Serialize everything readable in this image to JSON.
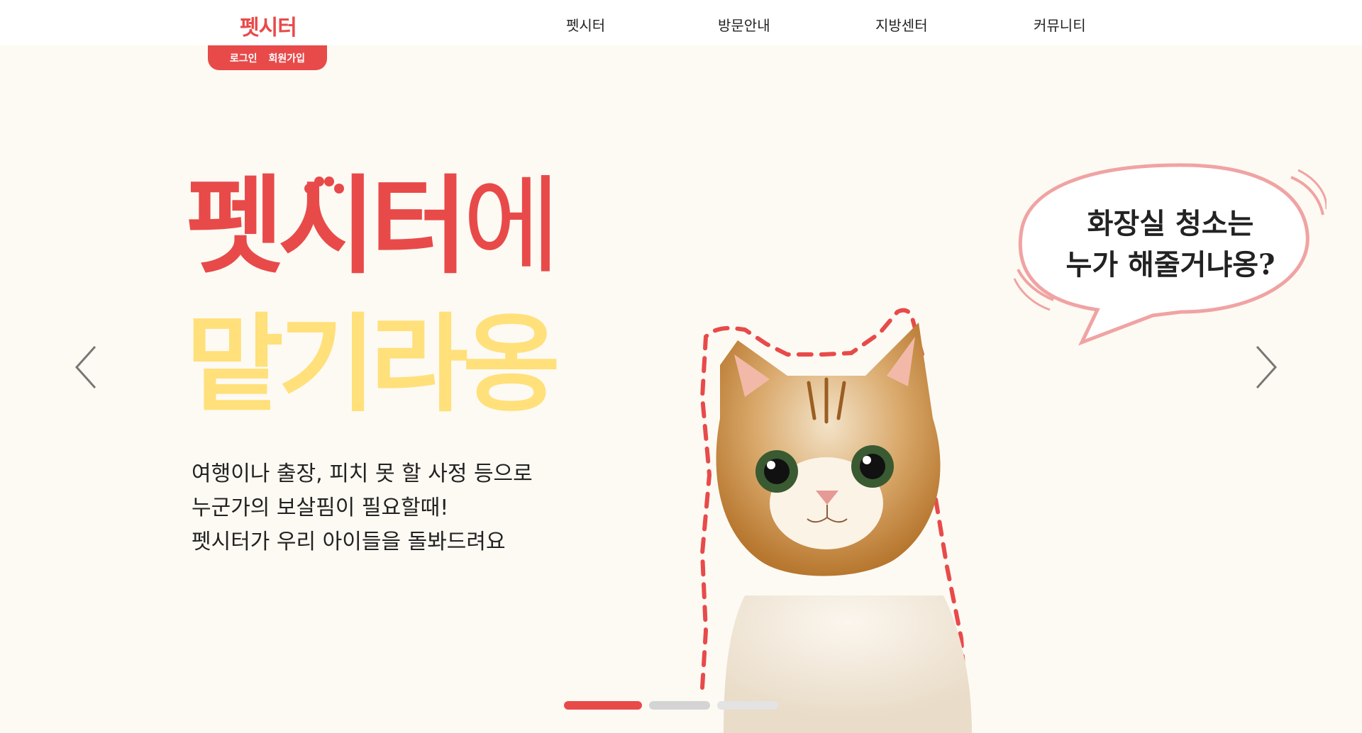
{
  "header": {
    "logo": "펫시터",
    "nav": [
      "펫시터",
      "방문안내",
      "지방센터",
      "커뮤니티"
    ],
    "auth": {
      "login": "로그인",
      "signup": "회원가입"
    }
  },
  "hero": {
    "title_line1_main": "펫시터",
    "title_line1_suffix": "에",
    "title_line2": "맡기라옹",
    "description": [
      "여행이나 출장, 피치 못 할 사정 등으로",
      "누군가의 보살핌이 필요할때!",
      "펫시터가 우리 아이들을 돌봐드려요"
    ],
    "bubble": [
      "화장실 청소는",
      "누가 해줄거냐옹?"
    ]
  },
  "slider": {
    "active_index": 0,
    "slide_count": 3
  },
  "icons": {
    "prev": "chevron-left-icon",
    "next": "chevron-right-icon",
    "paw": "paw-icon"
  },
  "colors": {
    "accent": "#e84a4a",
    "yellow": "#ffe07a",
    "background": "#fdfaf3",
    "bubble": "#f0a3a3"
  }
}
